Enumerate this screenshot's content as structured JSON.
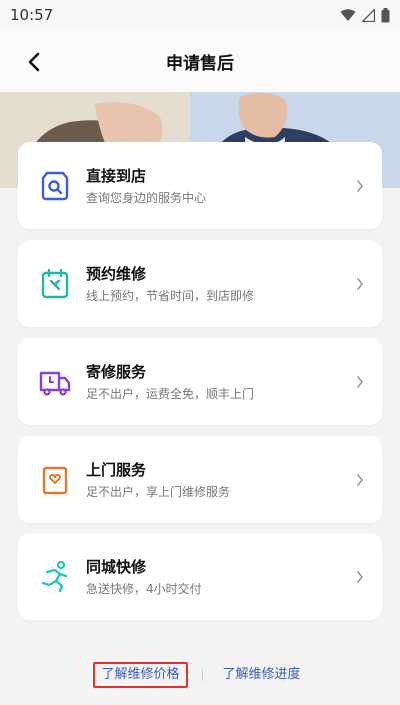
{
  "status_bar": {
    "time": "10:57"
  },
  "header": {
    "title": "申请售后"
  },
  "services": [
    {
      "title": "直接到店",
      "subtitle": "查询您身边的服务中心",
      "icon": "store-search-icon",
      "color": "#3a5fcf"
    },
    {
      "title": "预约维修",
      "subtitle": "线上预约，节省时间，到店即修",
      "icon": "calendar-wrench-icon",
      "color": "#1fb7a8"
    },
    {
      "title": "寄修服务",
      "subtitle": "足不出户，运费全免，顺丰上门",
      "icon": "delivery-truck-icon",
      "color": "#8a3fd1"
    },
    {
      "title": "上门服务",
      "subtitle": "足不出户，享上门维修服务",
      "icon": "home-service-icon",
      "color": "#e07a2a"
    },
    {
      "title": "同城快修",
      "subtitle": "急送快修，4小时交付",
      "icon": "running-courier-icon",
      "color": "#1fc7b8"
    }
  ],
  "footer": {
    "price_link": "了解维修价格",
    "progress_link": "了解维修进度"
  }
}
